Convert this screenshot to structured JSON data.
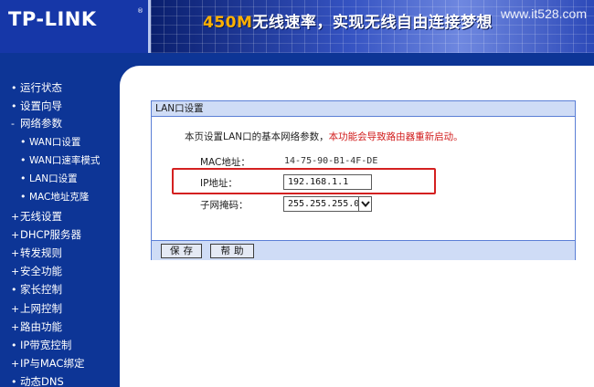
{
  "header": {
    "logo": "TP-LINK",
    "logo_mark": "®",
    "slogan_highlight": "450M",
    "slogan_rest": "无线速率，实现无线自由连接梦想",
    "watermark": "www.it528.com"
  },
  "sidebar": {
    "items": [
      {
        "label": "运行状态",
        "bullet": "•"
      },
      {
        "label": "设置向导",
        "bullet": "•"
      },
      {
        "label": "网络参数",
        "bullet": "-"
      },
      {
        "label": "WAN口设置",
        "bullet": "•"
      },
      {
        "label": "WAN口速率模式",
        "bullet": "•"
      },
      {
        "label": "LAN口设置",
        "bullet": "•"
      },
      {
        "label": "MAC地址克隆",
        "bullet": "•"
      },
      {
        "label": "无线设置",
        "bullet": "+"
      },
      {
        "label": "DHCP服务器",
        "bullet": "+"
      },
      {
        "label": "转发规则",
        "bullet": "+"
      },
      {
        "label": "安全功能",
        "bullet": "+"
      },
      {
        "label": "家长控制",
        "bullet": "•"
      },
      {
        "label": "上网控制",
        "bullet": "+"
      },
      {
        "label": "路由功能",
        "bullet": "+"
      },
      {
        "label": "IP带宽控制",
        "bullet": "•"
      },
      {
        "label": "IP与MAC绑定",
        "bullet": "+"
      },
      {
        "label": "动态DNS",
        "bullet": "•"
      }
    ]
  },
  "panel": {
    "title": "LAN口设置",
    "desc": "本页设置LAN口的基本网络参数，",
    "warning": "本功能会导致路由器重新启动。",
    "mac_label": "MAC地址：",
    "mac_value": "14-75-90-B1-4F-DE",
    "ip_label": "IP地址：",
    "ip_value": "192.168.1.1",
    "mask_label": "子网掩码：",
    "mask_value": "255.255.255.0",
    "save_label": "保存",
    "help_label": "帮助"
  },
  "colors": {
    "sidebar_bg": "#0d3596",
    "panel_header": "#cfdcf6",
    "highlight_border": "#d42020",
    "warning_text": "#d11c1c"
  }
}
